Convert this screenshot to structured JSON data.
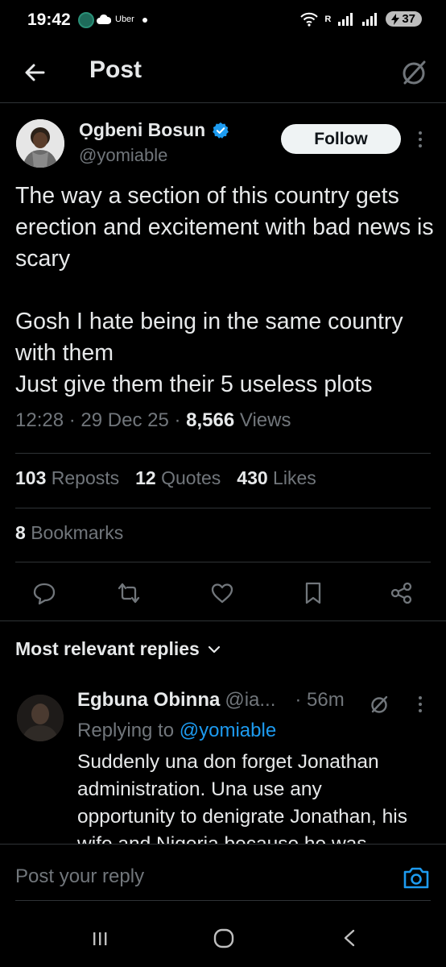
{
  "status_bar": {
    "time": "19:42",
    "uber_label": "Uber",
    "network_label": "R",
    "battery": "37"
  },
  "header": {
    "title": "Post"
  },
  "tweet": {
    "author_name": "Ọgbeni Bosun",
    "author_handle": "@yomiable",
    "follow_label": "Follow",
    "text": "The way a section of this country gets erection and excitement with bad news is scary\n\nGosh I hate being in the same country with them\nJust give them their 5 useless plots",
    "time": "12:28",
    "date": "29 Dec 25",
    "views_count": "8,566",
    "views_label": "Views",
    "reposts_count": "103",
    "reposts_label": "Reposts",
    "quotes_count": "12",
    "quotes_label": "Quotes",
    "likes_count": "430",
    "likes_label": "Likes",
    "bookmarks_count": "8",
    "bookmarks_label": "Bookmarks"
  },
  "replies_section": {
    "sort_label": "Most relevant replies"
  },
  "reply": {
    "name": "Egbuna Obinna",
    "handle": "@ia...",
    "time": "· 56m",
    "replying_prefix": "Replying to",
    "replying_to": "@yomiable",
    "text": "Suddenly una don forget Jonathan administration. Una use any opportunity to denigrate Jonathan, his wife and Nigeria because he was"
  },
  "composer": {
    "placeholder": "Post your reply"
  },
  "colors": {
    "background": "#000000",
    "text_primary": "#e7e9ea",
    "text_secondary": "#71767b",
    "accent": "#1d9bf0",
    "divider": "#2f3336"
  }
}
